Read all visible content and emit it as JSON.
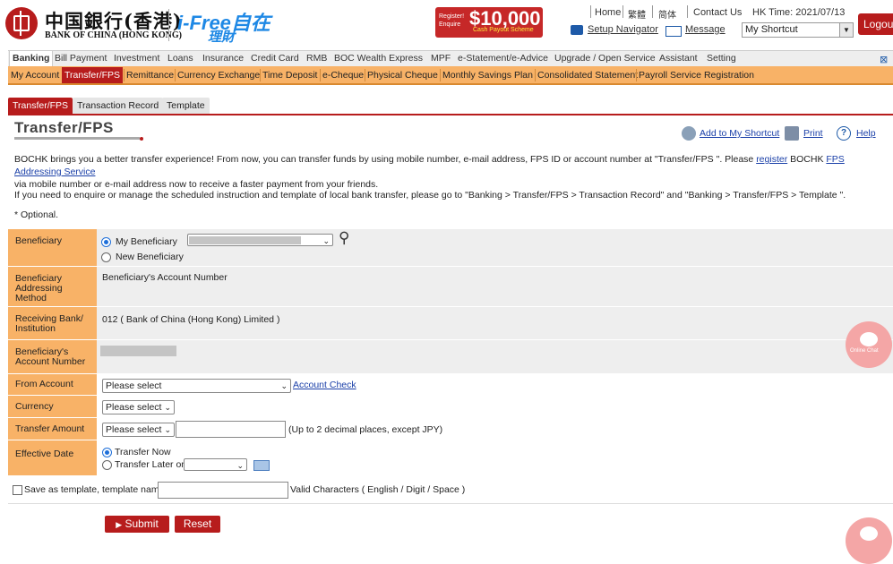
{
  "header": {
    "bank_name_cn": "中国銀行(香港)",
    "bank_name_en": "BANK OF CHINA (HONG KONG)",
    "ifree_main": "i-Free自在",
    "ifree_sub": "理財",
    "banner_left": "Register! Enquire",
    "banner_amount": "$10,000",
    "banner_sub": "Cash Payout Scheme",
    "links": [
      "Home",
      "繁體",
      "简体",
      "Contact Us"
    ],
    "hk_time": "HK Time: 2021/07/13",
    "logout": "Logout",
    "setup_navigator": "Setup Navigator",
    "message": "Message",
    "shortcut_select": "My Shortcut"
  },
  "menu_primary": [
    "Banking",
    "Bill Payment",
    "Investment",
    "Loans",
    "Insurance",
    "Credit Card",
    "RMB",
    "BOC Wealth Express",
    "MPF",
    "e-Statement/e-Advice",
    "Upgrade / Open Service",
    "Assistant",
    "Setting"
  ],
  "menu_secondary": [
    "My Account",
    "Transfer/FPS",
    "Remittance",
    "Currency Exchange",
    "Time Deposit",
    "e-Cheque",
    "Physical Cheque",
    "Monthly Savings Plan",
    "Consolidated Statement",
    "Payroll Service Registration"
  ],
  "subtabs": [
    "Transfer/FPS",
    "Transaction Record",
    "Template"
  ],
  "page": {
    "title": "Transfer/FPS",
    "add_shortcut": "Add to My Shortcut",
    "print": "Print",
    "help": "Help",
    "intro_1a": "BOCHK brings you a better transfer experience! From now, you can transfer funds by using mobile number, e-mail address, FPS ID or account number at \"Transfer/FPS \". Please ",
    "intro_register": "register",
    "intro_1b": " BOCHK ",
    "intro_fps": "FPS Addressing Service",
    "intro_2": "via mobile number or e-mail address now to receive a faster payment from your friends.",
    "intro_3": "If you need to enquire or manage the scheduled instruction and template of local bank transfer, please go to \"Banking > Transfer/FPS > Transaction Record\" and \"Banking > Transfer/FPS > Template \".",
    "optional_note": "* Optional."
  },
  "form": {
    "beneficiary_label": "Beneficiary",
    "my_beneficiary": "My Beneficiary",
    "new_beneficiary": "New Beneficiary",
    "addressing_label": "Beneficiary Addressing Method",
    "addressing_value": "Beneficiary's Account Number",
    "bank_label": "Receiving Bank/ Institution",
    "bank_value": "012 ( Bank of China (Hong Kong) Limited )",
    "account_label": "Beneficiary's Account Number",
    "from_label": "From Account",
    "from_value": "Please select",
    "account_check": "Account Check",
    "currency_label": "Currency",
    "currency_value": "Please select",
    "amount_label": "Transfer Amount",
    "amount_currency": "Please select",
    "amount_hint": "(Up to 2 decimal places, except JPY)",
    "date_label": "Effective Date",
    "transfer_now": "Transfer Now",
    "transfer_later": "Transfer Later on",
    "template_label": "Save as template, template name",
    "template_hint": "Valid Characters ( English / Digit / Space )",
    "submit": "Submit",
    "reset": "Reset"
  },
  "chat": {
    "label": "Online Chat"
  }
}
